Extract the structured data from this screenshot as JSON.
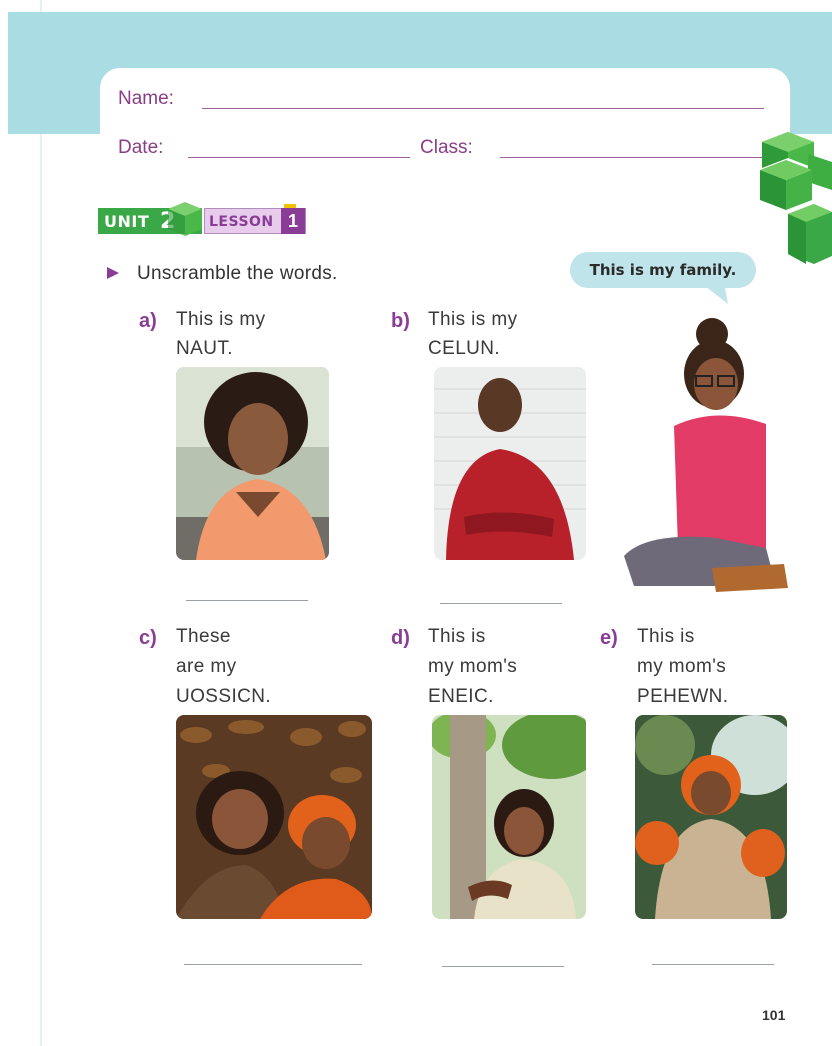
{
  "header": {
    "name_label": "Name:",
    "date_label": "Date:",
    "class_label": "Class:"
  },
  "badge": {
    "unit_label": "UNIT",
    "unit_number": "2",
    "lesson_label": "LESSON",
    "lesson_number": "1"
  },
  "instruction": "Unscramble the words.",
  "speech_bubble": "This is my family.",
  "items": [
    {
      "letter": "a)",
      "lines": [
        "This is my",
        "NAUT."
      ]
    },
    {
      "letter": "b)",
      "lines": [
        "This is my",
        "CELUN."
      ]
    },
    {
      "letter": "c)",
      "lines": [
        "These",
        "are my",
        "UOSSICN."
      ]
    },
    {
      "letter": "d)",
      "lines": [
        "This is",
        "my mom's",
        "ENEIC."
      ]
    },
    {
      "letter": "e)",
      "lines": [
        "This is",
        "my mom's",
        "PEHEWN."
      ]
    }
  ],
  "page_number": "101",
  "colors": {
    "accent_purple": "#8a3d96",
    "unit_green": "#3aa846",
    "header_band": "#a9dde3"
  }
}
